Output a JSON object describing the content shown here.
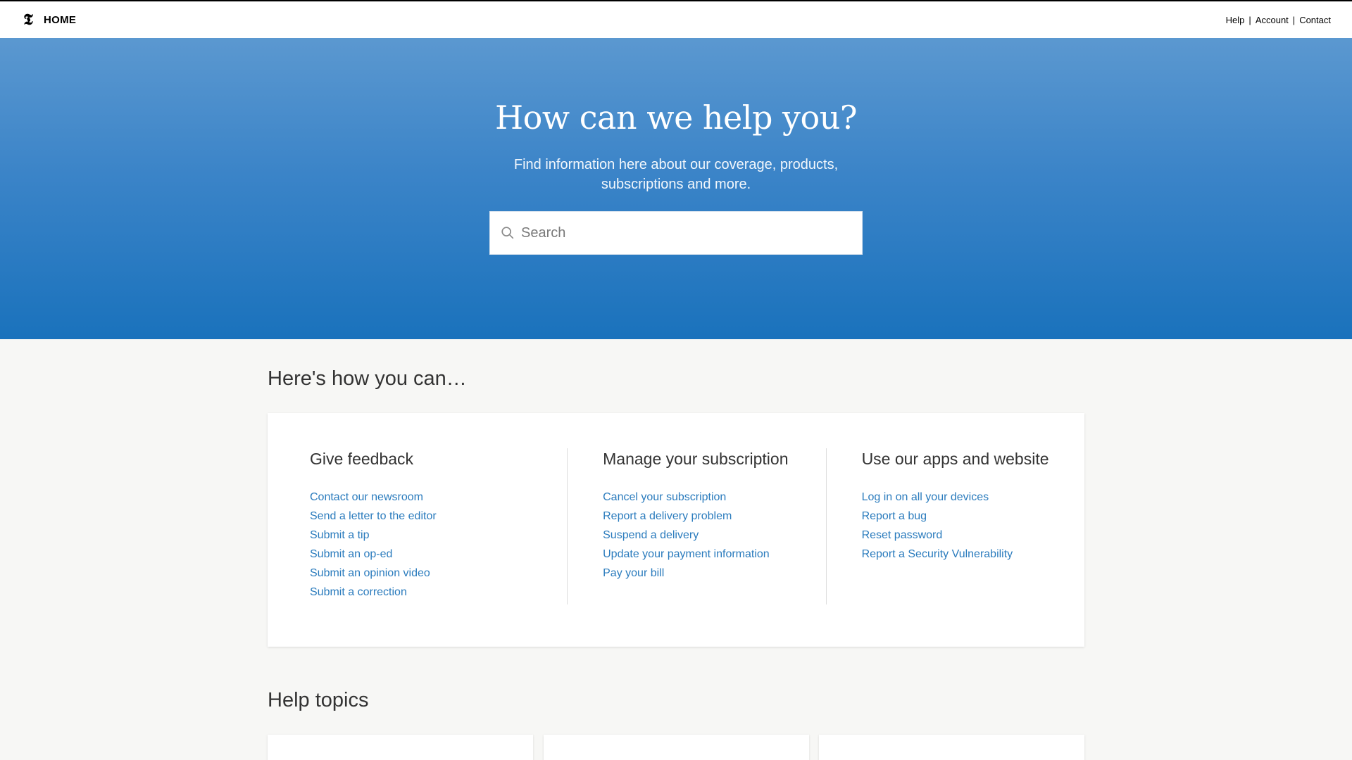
{
  "header": {
    "logo_glyph": "𝕿",
    "home_label": "HOME",
    "nav": [
      "Help",
      "Account",
      "Contact"
    ],
    "separator": "|"
  },
  "hero": {
    "title": "How can we help you?",
    "subtitle": "Find information here about our coverage, products, subscriptions and more.",
    "search": {
      "placeholder": "Search",
      "value": ""
    },
    "colors": {
      "top": "#5b98d0",
      "bottom": "#1a72bc"
    }
  },
  "how_section": {
    "title": "Here's how you can…",
    "columns": [
      {
        "heading": "Give feedback",
        "links": [
          "Contact our newsroom",
          "Send a letter to the editor",
          "Submit a tip",
          "Submit an op-ed",
          "Submit an opinion video",
          "Submit a correction"
        ]
      },
      {
        "heading": "Manage your subscription",
        "links": [
          "Cancel your subscription",
          "Report a delivery problem",
          "Suspend a delivery",
          "Update your payment information",
          "Pay your bill"
        ]
      },
      {
        "heading": "Use our apps and website",
        "links": [
          "Log in on all your devices",
          "Report a bug",
          "Reset password",
          "Report a Security Vulnerability"
        ]
      }
    ]
  },
  "topics_section": {
    "title": "Help topics"
  },
  "colors": {
    "link": "#2a7bbd",
    "page_bg": "#f7f7f5"
  }
}
